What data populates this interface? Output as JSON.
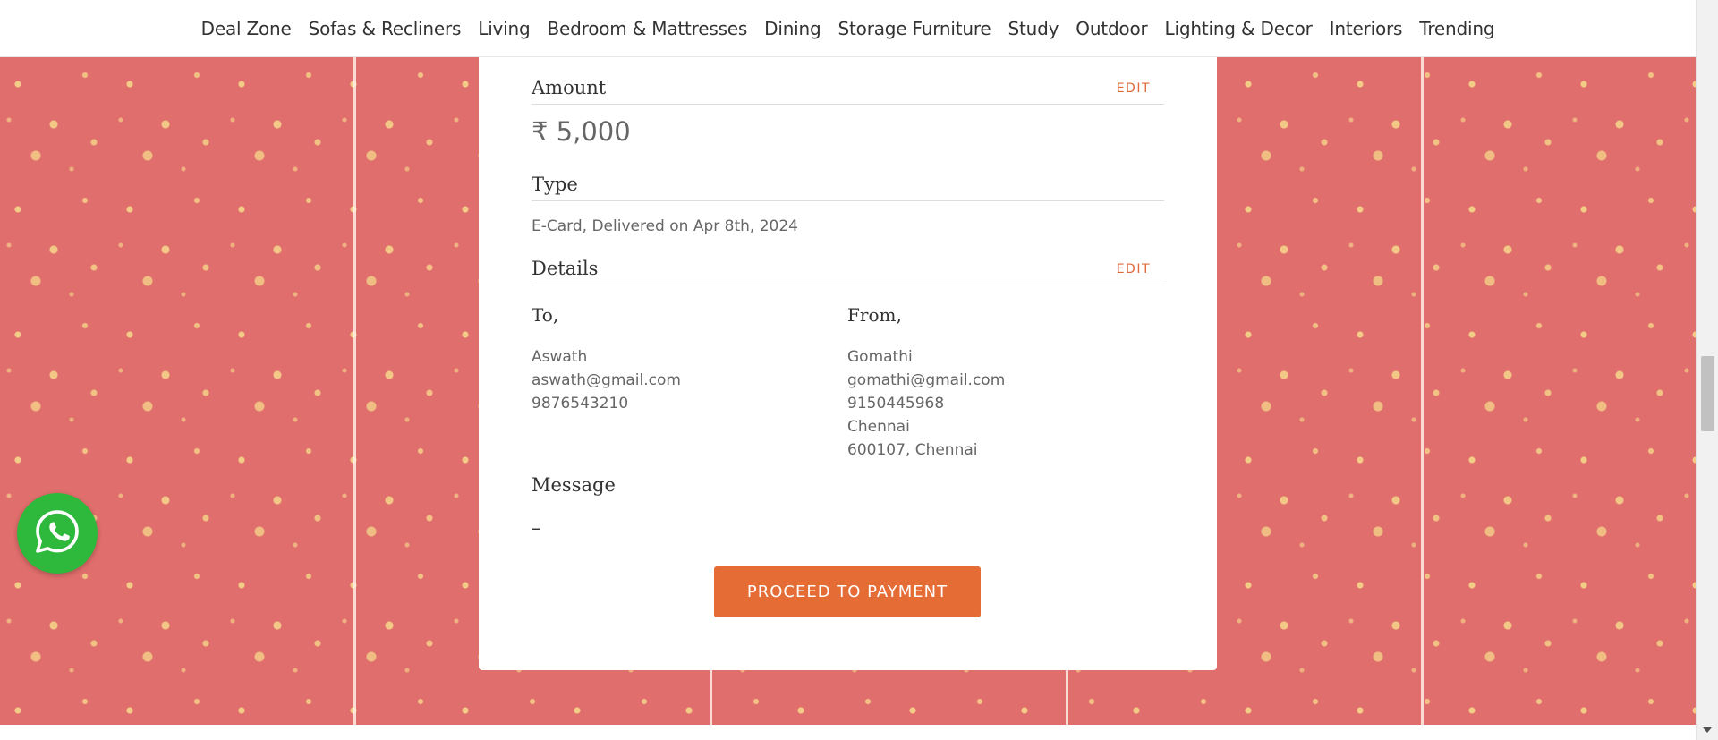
{
  "nav": {
    "items": [
      "Deal Zone",
      "Sofas & Recliners",
      "Living",
      "Bedroom & Mattresses",
      "Dining",
      "Storage Furniture",
      "Study",
      "Outdoor",
      "Lighting & Decor",
      "Interiors",
      "Trending"
    ]
  },
  "card": {
    "amount_title": "Amount",
    "amount_edit": "EDIT",
    "amount_value": "₹ 5,000",
    "type_title": "Type",
    "type_value": "E-Card, Delivered on Apr 8th, 2024",
    "details_title": "Details",
    "details_edit": "EDIT",
    "to": {
      "label": "To,",
      "name": "Aswath",
      "email": "aswath@gmail.com",
      "phone": "9876543210"
    },
    "from": {
      "label": "From,",
      "name": "Gomathi",
      "email": "gomathi@gmail.com",
      "phone": "9150445968",
      "city": "Chennai",
      "address": "600107, Chennai"
    },
    "message_title": "Message",
    "message_value": "–",
    "proceed_label": "PROCEED TO PAYMENT"
  },
  "icons": {
    "whatsapp": "whatsapp-icon"
  },
  "colors": {
    "accent": "#e56d35",
    "background_pattern": "#e06e6c",
    "whatsapp": "#2fb93c"
  }
}
